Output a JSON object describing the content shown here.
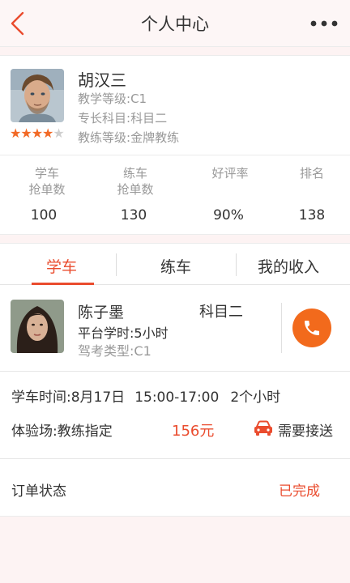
{
  "header": {
    "title": "个人中心"
  },
  "coach": {
    "name": "胡汉三",
    "teaching_level_label": "教学等级:",
    "teaching_level": "C1",
    "specialty_label": "专长科目:",
    "specialty": "科目二",
    "coach_level_label": "教练等级:",
    "coach_level": "金牌教练",
    "rating_stars": 4,
    "rating_max": 5
  },
  "stats": [
    {
      "label": "学车\n抢单数",
      "value": "100"
    },
    {
      "label": "练车\n抢单数",
      "value": "130"
    },
    {
      "label": "好评率",
      "value": "90%"
    },
    {
      "label": "排名",
      "value": "138"
    }
  ],
  "tabs": [
    {
      "label": "学车",
      "active": true
    },
    {
      "label": "练车",
      "active": false
    },
    {
      "label": "我的收入",
      "active": false
    }
  ],
  "order": {
    "student_name": "陈子墨",
    "subject": "科目二",
    "platform_hours_label": "平台学时:",
    "platform_hours": "5小时",
    "exam_type_label": "驾考类型:",
    "exam_type": "C1",
    "time_label": "学车时间:",
    "date": "8月17日",
    "time_range": "15:00-17:00",
    "duration": "2个小时",
    "venue_label": "体验场:",
    "venue": "教练指定",
    "price": "156元",
    "pickup": "需要接送",
    "status_label": "订单状态",
    "status": "已完成"
  },
  "colors": {
    "accent": "#ea4c2e",
    "call_button": "#f26a1c",
    "background": "#fdf3f3"
  }
}
